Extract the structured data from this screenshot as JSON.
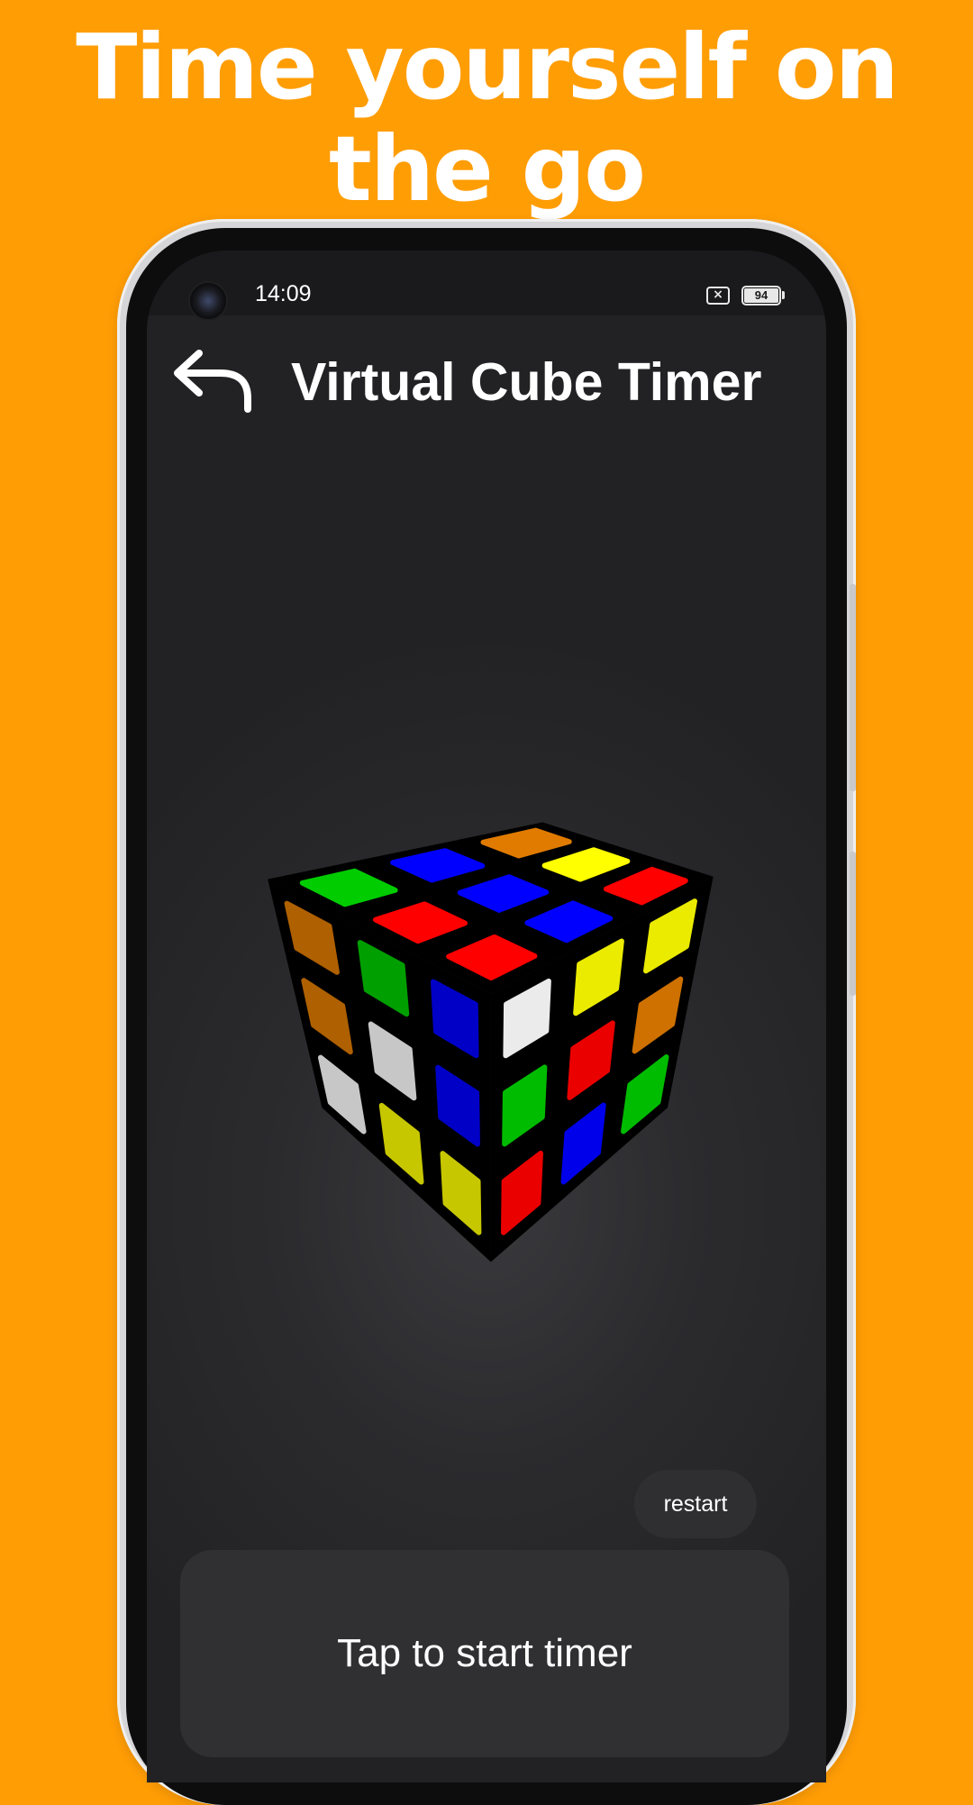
{
  "promo": {
    "headline_line1": "Time yourself on",
    "headline_line2": "the go"
  },
  "status_bar": {
    "time": "14:09",
    "battery_level": "94"
  },
  "header": {
    "title": "Virtual Cube Timer",
    "back_icon": "back-arrow-icon"
  },
  "cube": {
    "description_colors": {
      "red": "#ff0000",
      "green": "#00cc00",
      "blue": "#0000ff",
      "yellow": "#ffff00",
      "white": "#ffffff",
      "orange": "#e07b00"
    }
  },
  "controls": {
    "restart_label": "restart",
    "start_timer_label": "Tap to start timer"
  },
  "colors": {
    "background": "#FF9D05",
    "screen": "#28282b"
  }
}
